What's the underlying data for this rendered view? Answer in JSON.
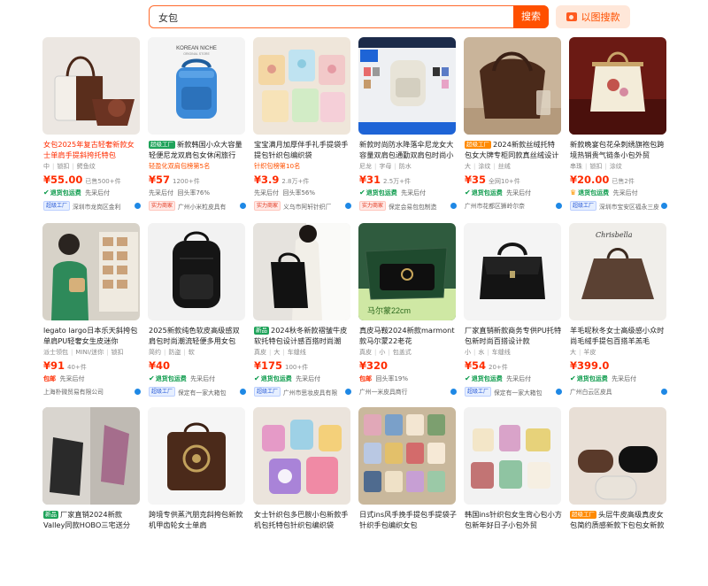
{
  "search": {
    "query": "女包",
    "button": "搜索",
    "image_search": "以图搜款"
  },
  "row1": [
    {
      "title": "女包2025年复古轻奢新款女士单肩手提斜挎托特包",
      "tags": [
        "中",
        "锁扣",
        "鳄鱼纹"
      ],
      "price": "¥55.00",
      "sales": "已售500+件",
      "promo": "退货包运费",
      "promo2": "先采后付",
      "shop_tag": "超级工厂",
      "shop": "深圳市龙岗区金利"
    },
    {
      "title_badge": "超级工厂",
      "title": "新款韩国小众大容量轻便尼龙双肩包女休闲旅行",
      "sub": "轻盈化双肩包榜第5名",
      "price": "¥57",
      "sales": "1200+件",
      "promo": "先采后付",
      "promo2": "回头率76%",
      "shop_tag": "实力商家",
      "shop": "广州小米粒皮具有"
    },
    {
      "title": "宝宝满月加厚伴手礼手提袋手提包针织包编织袋",
      "sub": "针织包榜第10名",
      "price": "¥3.9",
      "sales": "2.8万+件",
      "promo": "先采后付",
      "promo2": "回头率56%",
      "shop_tag": "实力商家",
      "shop": "义乌市阿轩针织厂"
    },
    {
      "title": "新款时尚防水降落伞尼龙女大容量双肩包通勤双肩包时尚小众",
      "tags": [
        "尼龙",
        "字母",
        "防水"
      ],
      "price": "¥31",
      "sales": "2.5万+件",
      "promo": "退货包运费",
      "promo2": "先采后付",
      "shop_tag": "实力商家",
      "shop": "保定会易包包制造"
    },
    {
      "title_badge": "超级工厂",
      "title": "2024新款丝绒托特包女大牌专柜同款真丝绒设计",
      "tags": [
        "大",
        "涂纹",
        "丝绒"
      ],
      "price": "¥35",
      "sales": "全网10+件",
      "promo": "退货包运费",
      "promo2": "先采后付",
      "shop_tag": "",
      "shop": "广州市花都区狮岭尔奈"
    },
    {
      "title": "新款晚宴包花朵刺绣旗袍包跨境热销贵气链条小包外贸",
      "tags": [
        "串珠",
        "锁扣",
        "涂纹"
      ],
      "price": "¥20.00",
      "sales": "已售2件",
      "promo": "退货包运费",
      "promo2": "先采后付",
      "shop_tag": "超级工厂",
      "shop": "深圳市宝安区福永三皮具厂"
    }
  ],
  "row2": [
    {
      "title": "legato largo日本乐天斜挎包单肩PU轻奢女生皮迷你",
      "tags": [
        "派士领包",
        "MINI/迷你",
        "锁扣"
      ],
      "price": "¥91",
      "sales": "40+件",
      "promo": "包邮",
      "promo2": "先采后付",
      "shop": "上海朴微贸易有限公司"
    },
    {
      "title": "2025新款纯色软皮高级感双肩包时尚潮流轻便多用女包",
      "tags": [
        "简约",
        "防盗",
        "软"
      ],
      "price": "¥40",
      "sales": "",
      "promo": "退货包运费",
      "promo2": "先采后付",
      "shop_tag": "超级工厂",
      "shop": "保定有一家大箱包"
    },
    {
      "title_badge": "新品",
      "title": "2024秋冬新款褶皱牛皮软托特包设计感百搭时尚潮",
      "tags": [
        "真皮",
        "大",
        "车缝线"
      ],
      "price": "¥175",
      "sales": "100+件",
      "promo": "退货包运费",
      "promo2": "先采后付",
      "shop_tag": "超级工厂",
      "shop": "广州市思妆皮具有限"
    },
    {
      "title": "真皮马鞍2024新款marmont款马尔蒙22老花",
      "tags": [
        "真皮",
        "小",
        "包盖式"
      ],
      "price": "¥320",
      "sales": "",
      "promo": "包邮",
      "promo2": "回头率19%",
      "shop": "广州一米皮具商行"
    },
    {
      "title": "厂家直销新款商务专供PU托特包新时尚百搭设计款",
      "tags": [
        "小",
        "水",
        "车缝线"
      ],
      "price": "¥54",
      "sales": "20+件",
      "promo": "退货包运费",
      "promo2": "先采后付",
      "shop_tag": "超级工厂",
      "shop": "保定有一家大箱包"
    },
    {
      "title": "羊毛呢秋冬女士高级感小众时尚毛绒手提包百搭羊羔毛",
      "tags": [
        "大",
        "羊皮"
      ],
      "price": "¥399.0",
      "sales": "",
      "promo": "退货包运费",
      "promo2": "先采后付",
      "shop": "广州白云区皮具"
    }
  ],
  "row3": [
    {
      "title_badge": "新品",
      "title": "厂家直销2024新款Valley同款HOBO三宅送分PVC"
    },
    {
      "title": "跨境专供蒸汽朋克斜挎包新款机甲齿轮女士单肩"
    },
    {
      "title": "女士针织包多巴胺小包新款手机包托特包针织包编织袋"
    },
    {
      "title": "日式ins风手挽手提包手提袋子针织手包编织女包"
    },
    {
      "title": "韩国ins针织包女生背心包小方包新年好日子小包外贸"
    },
    {
      "title_badge": "超级工厂",
      "title": "头层牛皮高级真皮女包简约质感新款下包包女新款"
    }
  ],
  "colors": {
    "accent": "#ff5000",
    "price": "#ff2c00",
    "green": "#0a9a4a"
  }
}
